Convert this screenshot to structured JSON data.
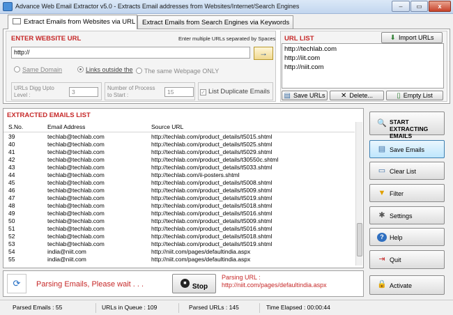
{
  "window": {
    "title": "Advance Web Email Extractor v5.0 - Extracts Email addresses from Websites/Internet/Search Engines",
    "minimize": "–",
    "maximize": "▭",
    "close": "x"
  },
  "tabs": [
    {
      "label": "Extract Emails from Websites via URL"
    },
    {
      "label": "Extract Emails from Search Engines via Keywords"
    }
  ],
  "url_section": {
    "title": "ENTER WEBSITE URL",
    "hint": "Enter multiple URLs separated by Spaces",
    "url_value": "http://",
    "go_arrow": "→",
    "radio_same_domain": "Same Domain",
    "radio_links_outside": "Links outside the",
    "radio_same_page": "The same Webpage ONLY",
    "dig_label_1": "URLs Digg Upto",
    "dig_label_2": "Level :",
    "dig_value": "3",
    "process_label_1": "Number of Process",
    "process_label_2": "to Start :",
    "process_value": "15",
    "list_duplicate": "List Duplicate Emails"
  },
  "url_list": {
    "title": "URL LIST",
    "import_button": "Import URLs",
    "items": [
      "http://techlab.com",
      "http://iit.com",
      "http://niit.com"
    ],
    "save_button": "Save URLs",
    "delete_button": "Delete...",
    "empty_button": "Empty List"
  },
  "results": {
    "title": "EXTRACTED EMAILS LIST",
    "columns": [
      "S.No.",
      "Email Address",
      "Source URL"
    ],
    "rows": [
      [
        "39",
        "techlab@techlab.com",
        "http://techlab.com/product_details/t5015.shtml"
      ],
      [
        "40",
        "techlab@techlab.com",
        "http://techlab.com/product_details/t5025.shtml"
      ],
      [
        "41",
        "techlab@techlab.com",
        "http://techlab.com/product_details/t5029.shtml"
      ],
      [
        "42",
        "techlab@techlab.com",
        "http://techlab.com/product_details/t30550c.shtml"
      ],
      [
        "43",
        "techlab@techlab.com",
        "http://techlab.com/product_details/t5033.shtml"
      ],
      [
        "44",
        "techlab@techlab.com",
        "http://techlab.com/ii-posters.shtml"
      ],
      [
        "45",
        "techlab@techlab.com",
        "http://techlab.com/product_details/t5008.shtml"
      ],
      [
        "46",
        "techlab@techlab.com",
        "http://techlab.com/product_details/t5009.shtml"
      ],
      [
        "47",
        "techlab@techlab.com",
        "http://techlab.com/product_details/t5019.shtml"
      ],
      [
        "48",
        "techlab@techlab.com",
        "http://techlab.com/product_details/t5018.shtml"
      ],
      [
        "49",
        "techlab@techlab.com",
        "http://techlab.com/product_details/t5016.shtml"
      ],
      [
        "50",
        "techlab@techlab.com",
        "http://techlab.com/product_details/t5009.shtml"
      ],
      [
        "51",
        "techlab@techlab.com",
        "http://techlab.com/product_details/t5016.shtml"
      ],
      [
        "52",
        "techlab@techlab.com",
        "http://techlab.com/product_details/t5018.shtml"
      ],
      [
        "53",
        "techlab@techlab.com",
        "http://techlab.com/product_details/t5019.shtml"
      ],
      [
        "54",
        "india@niit.com",
        "http://niit.com/pages/defaultindia.aspx"
      ],
      [
        "55",
        "india@niit.com",
        "http://niit.com/pages/defaultindia.aspx"
      ]
    ]
  },
  "progress": {
    "parsing_text": "Parsing Emails, Please wait . . .",
    "stop_button": "Stop",
    "parsing_url_label": "Parsing URL :",
    "parsing_url_value": "http://niit.com/pages/defaultindia.aspx"
  },
  "sidebar": {
    "start": "START EXTRACTING EMAILS",
    "save_emails": "Save Emails",
    "clear_list": "Clear List",
    "filter": "Filter",
    "settings": "Settings",
    "help": "Help",
    "quit": "Quit",
    "activate": "Activate"
  },
  "statusbar": {
    "parsed_emails": "Parsed Emails :  55",
    "urls_in_queue": "URLs in Queue :  109",
    "parsed_urls": "Parsed URLs :  145",
    "time_elapsed": "Time Elapsed :   00:00:44"
  },
  "colors": {
    "section_title": "#c62828",
    "parsing_text": "#c62828",
    "titlebar": "#c2d6ef"
  }
}
